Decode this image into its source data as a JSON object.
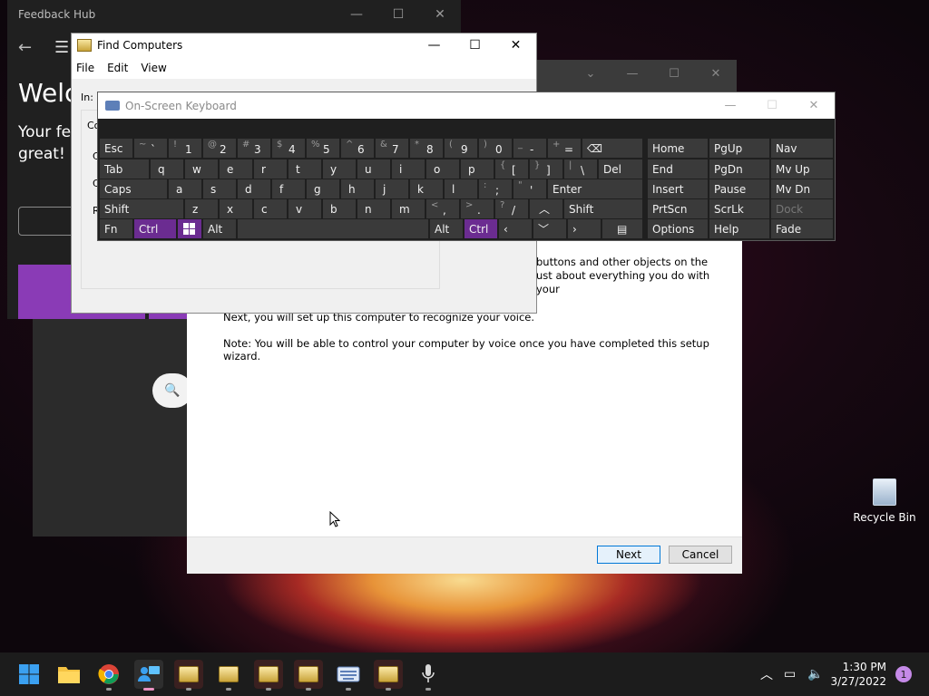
{
  "feedback_hub": {
    "title": "Feedback Hub",
    "welcome": "Welc",
    "subtitle_line1": "Your fe",
    "subtitle_line2": "great!",
    "caption_min": "—",
    "caption_max": "☐",
    "caption_close": "✕"
  },
  "find_computers": {
    "title": "Find Computers",
    "menus": [
      "File",
      "Edit",
      "View"
    ],
    "label_in": "In:",
    "label_co": "Co",
    "frag_c1": "C",
    "frag_c2": "C",
    "frag_r": "R"
  },
  "osk": {
    "title": "On-Screen Keyboard",
    "rows": {
      "r1": [
        "Esc",
        "~",
        "`",
        "!",
        "1",
        "@",
        "2",
        "#",
        "3",
        "$",
        "4",
        "%",
        "5",
        "^",
        "6",
        "&",
        "7",
        "*",
        "8",
        "(",
        "9",
        ")",
        "0",
        "_",
        "-",
        "+",
        "="
      ],
      "r2": [
        "Tab",
        "q",
        "w",
        "e",
        "r",
        "t",
        "y",
        "u",
        "i",
        "o",
        "p",
        "{",
        "[",
        "}",
        "]",
        "|",
        "\\",
        "Del"
      ],
      "r3": [
        "Caps",
        "a",
        "s",
        "d",
        "f",
        "g",
        "h",
        "j",
        "k",
        "l",
        ":",
        ";",
        "\"",
        "'",
        "Enter"
      ],
      "r4": [
        "Shift",
        "z",
        "x",
        "c",
        "v",
        "b",
        "n",
        "m",
        "<",
        ",",
        ">",
        ".",
        "?",
        "/",
        "Shift"
      ],
      "r5": [
        "Fn",
        "Ctrl",
        "Alt",
        "Alt",
        "Ctrl"
      ]
    },
    "nav": [
      "Home",
      "PgUp",
      "Nav",
      "End",
      "PgDn",
      "Mv Up",
      "Insert",
      "Pause",
      "Mv Dn",
      "PrtScn",
      "ScrLk",
      "Dock",
      "Options",
      "Help",
      "Fade"
    ]
  },
  "wizard": {
    "p1": "buttons and other objects on the",
    "p1b": "ust about everything you do with your",
    "p2": "Next, you will set up this computer to recognize your voice.",
    "p3": "Note: You will be able to control your computer by voice once you have completed this setup wizard.",
    "next_label": "Next",
    "cancel_label": "Cancel"
  },
  "desktop": {
    "recycle_bin": "Recycle Bin"
  },
  "taskbar": {
    "time": "1:30 PM",
    "date": "3/27/2022",
    "notification_count": "1"
  }
}
